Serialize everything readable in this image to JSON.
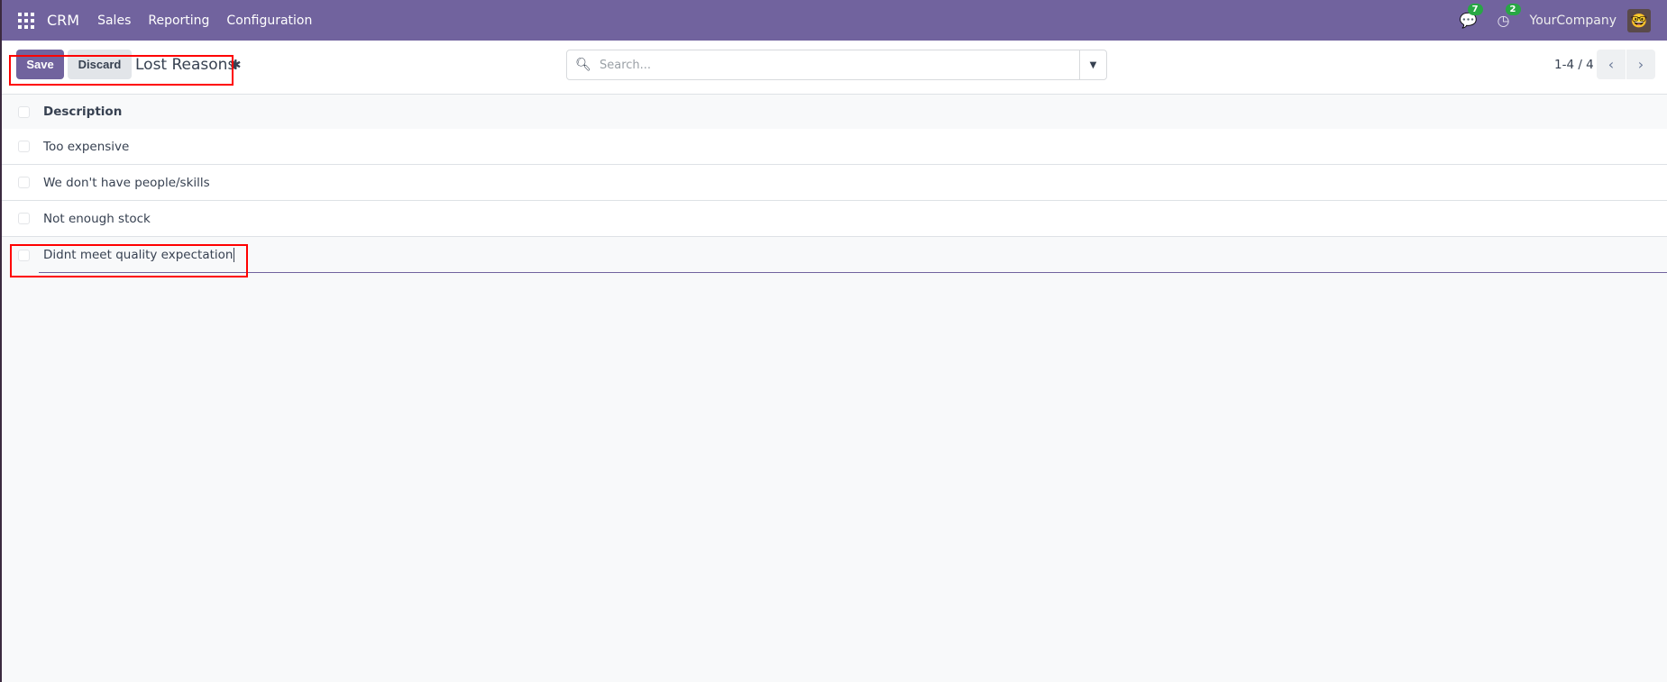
{
  "navbar": {
    "app": "CRM",
    "menus": [
      "Sales",
      "Reporting",
      "Configuration"
    ],
    "messages_count": "7",
    "activities_count": "2",
    "company": "YourCompany"
  },
  "control_panel": {
    "save": "Save",
    "discard": "Discard",
    "title": "Lost Reasons",
    "search_placeholder": "Search...",
    "pager": "1-4 / 4"
  },
  "list": {
    "column": "Description",
    "rows": [
      "Too expensive",
      "We don't have people/skills",
      "Not enough stock"
    ],
    "editing_row": "Didnt meet quality expectation"
  },
  "colors": {
    "brand": "#71639e",
    "badge": "#28a745",
    "annotation": "#ff0000"
  }
}
